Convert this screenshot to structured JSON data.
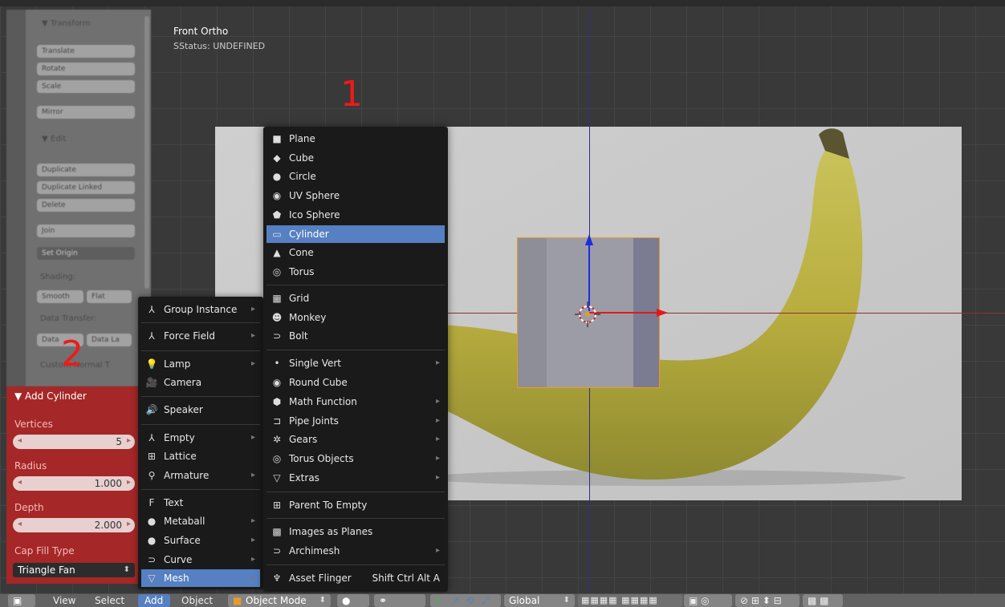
{
  "viewport": {
    "title": "Front Ortho",
    "status": "SStatus: UNDEFINED",
    "marker1": "1",
    "marker2": "2"
  },
  "shelf": {
    "header_transform": "▼ Transform",
    "header_edit": "▼ Edit",
    "buttons": [
      "Translate",
      "Rotate",
      "Scale",
      "Mirror",
      "Duplicate",
      "Duplicate Linked",
      "Delete",
      "Join",
      "Set Origin"
    ],
    "shading_label": "Shading:",
    "smooth": "Smooth",
    "flat": "Flat",
    "data_transfer": "Data Transfer:",
    "data": "Data",
    "data_layers": "Data La",
    "custom_normal": "Custom Normal T"
  },
  "operator": {
    "title": "▼ Add Cylinder",
    "vertices_label": "Vertices",
    "vertices_value": "5",
    "radius_label": "Radius",
    "radius_value": "1.000",
    "depth_label": "Depth",
    "depth_value": "2.000",
    "cap_label": "Cap Fill Type",
    "cap_value": "Triangle Fan"
  },
  "add_menu": [
    {
      "label": "Group Instance",
      "icon": "⅄",
      "sub": "▸"
    },
    {
      "label": "Force Field",
      "icon": "⅄",
      "sub": "▸"
    },
    {
      "label": "Lamp",
      "icon": "💡",
      "sub": "▸"
    },
    {
      "label": "Camera",
      "icon": "🎥",
      "sub": ""
    },
    {
      "label": "Speaker",
      "icon": "🔊",
      "sub": ""
    },
    {
      "label": "Empty",
      "icon": "⅄",
      "sub": "▸"
    },
    {
      "label": "Lattice",
      "icon": "⊞",
      "sub": ""
    },
    {
      "label": "Armature",
      "icon": "⚲",
      "sub": "▸"
    },
    {
      "label": "Text",
      "icon": "F",
      "sub": ""
    },
    {
      "label": "Metaball",
      "icon": "●",
      "sub": "▸"
    },
    {
      "label": "Surface",
      "icon": "●",
      "sub": "▸"
    },
    {
      "label": "Curve",
      "icon": "⊃",
      "sub": "▸"
    },
    {
      "label": "Mesh",
      "icon": "▽",
      "sub": "▸"
    }
  ],
  "mesh_menu": [
    {
      "label": "Plane",
      "icon": "■",
      "sub": ""
    },
    {
      "label": "Cube",
      "icon": "◆",
      "sub": ""
    },
    {
      "label": "Circle",
      "icon": "●",
      "sub": ""
    },
    {
      "label": "UV Sphere",
      "icon": "◉",
      "sub": ""
    },
    {
      "label": "Ico Sphere",
      "icon": "⬟",
      "sub": ""
    },
    {
      "label": "Cylinder",
      "icon": "▭",
      "sub": ""
    },
    {
      "label": "Cone",
      "icon": "▲",
      "sub": ""
    },
    {
      "label": "Torus",
      "icon": "◎",
      "sub": ""
    },
    {
      "label": "Grid",
      "icon": "▦",
      "sub": ""
    },
    {
      "label": "Monkey",
      "icon": "☻",
      "sub": ""
    },
    {
      "label": "Bolt",
      "icon": "⊃",
      "sub": ""
    },
    {
      "label": "Single Vert",
      "icon": "•",
      "sub": "▸"
    },
    {
      "label": "Round Cube",
      "icon": "◉",
      "sub": ""
    },
    {
      "label": "Math Function",
      "icon": "⬢",
      "sub": "▸"
    },
    {
      "label": "Pipe Joints",
      "icon": "⊐",
      "sub": "▸"
    },
    {
      "label": "Gears",
      "icon": "✲",
      "sub": "▸"
    },
    {
      "label": "Torus Objects",
      "icon": "◎",
      "sub": "▸"
    },
    {
      "label": "Extras",
      "icon": "▽",
      "sub": "▸"
    },
    {
      "label": "Parent To Empty",
      "icon": "⊞",
      "sub": ""
    },
    {
      "label": "Images as Planes",
      "icon": "▩",
      "sub": ""
    },
    {
      "label": "Archimesh",
      "icon": "⊃",
      "sub": "▸"
    },
    {
      "label": "Asset Flinger",
      "icon": "♆",
      "sub": "",
      "shortcut": "Shift Ctrl Alt A"
    }
  ],
  "header": {
    "view": "View",
    "select": "Select",
    "add": "Add",
    "object": "Object",
    "mode": "Object Mode",
    "orientation": "Global"
  }
}
